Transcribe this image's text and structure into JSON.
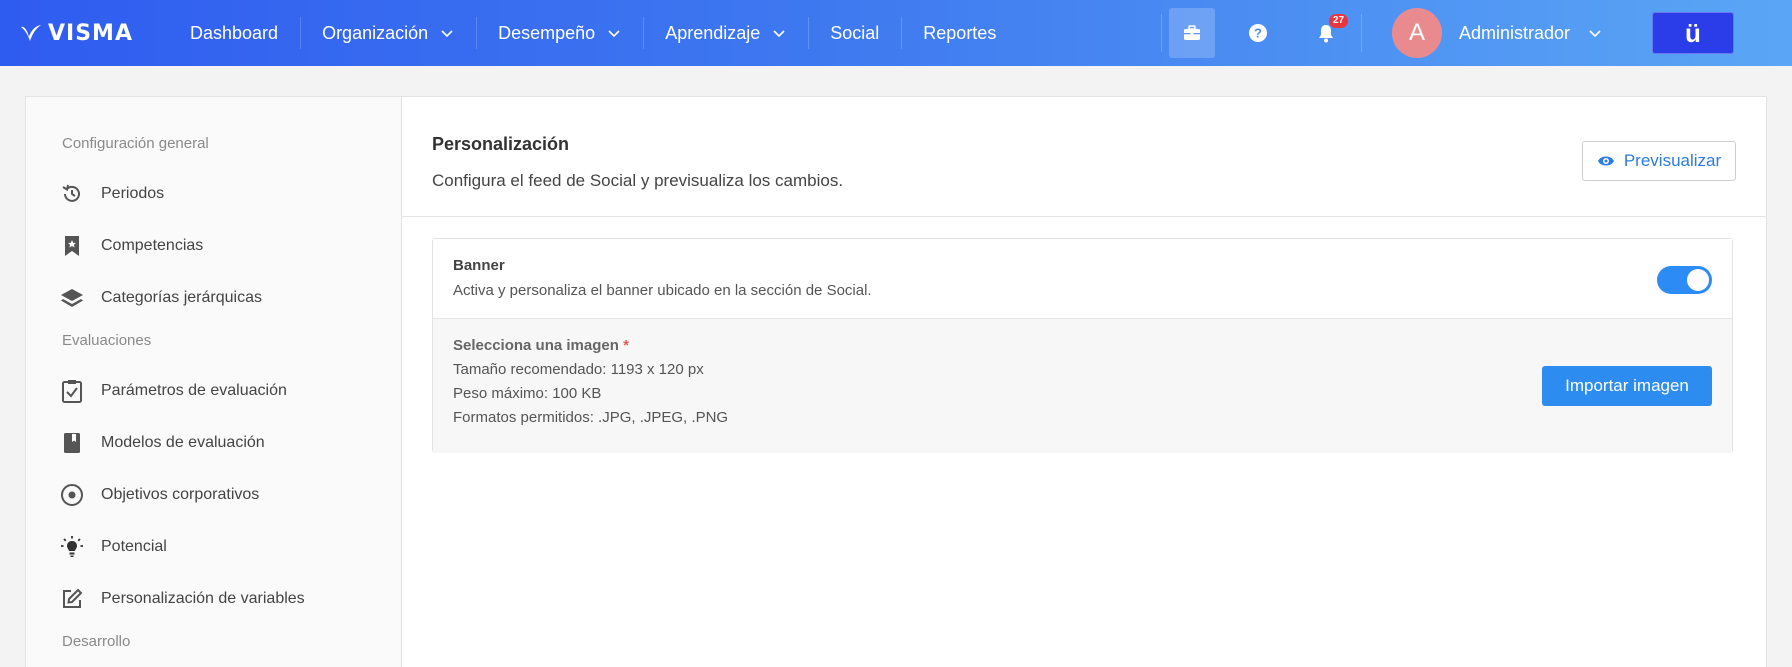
{
  "brand": {
    "logo_text": "VISMA"
  },
  "nav": {
    "items": [
      {
        "label": "Dashboard",
        "has_menu": false
      },
      {
        "label": "Organización",
        "has_menu": true
      },
      {
        "label": "Desempeño",
        "has_menu": true
      },
      {
        "label": "Aprendizaje",
        "has_menu": true
      },
      {
        "label": "Social",
        "has_menu": false
      },
      {
        "label": "Reportes",
        "has_menu": false
      }
    ]
  },
  "header": {
    "notifications_count": "27",
    "avatar_initial": "A",
    "user_name": "Administrador",
    "app_switch_label": "ü"
  },
  "sidebar": {
    "groups": [
      {
        "title": "Configuración general",
        "items": [
          {
            "label": "Periodos",
            "icon": "history-icon"
          },
          {
            "label": "Competencias",
            "icon": "bookmark-star-icon"
          },
          {
            "label": "Categorías jerárquicas",
            "icon": "layers-icon"
          }
        ]
      },
      {
        "title": "Evaluaciones",
        "items": [
          {
            "label": "Parámetros de evaluación",
            "icon": "clipboard-check-icon"
          },
          {
            "label": "Modelos de evaluación",
            "icon": "book-icon"
          },
          {
            "label": "Objetivos corporativos",
            "icon": "target-icon"
          },
          {
            "label": "Potencial",
            "icon": "lightbulb-icon"
          },
          {
            "label": "Personalización de variables",
            "icon": "edit-icon"
          }
        ]
      },
      {
        "title": "Desarrollo",
        "items": []
      }
    ]
  },
  "main": {
    "title": "Personalización",
    "subtitle": "Configura el feed de Social y previsualiza los cambios.",
    "preview_label": "Previsualizar",
    "banner": {
      "title": "Banner",
      "description": "Activa y personaliza el banner ubicado en la sección de Social.",
      "enabled": true,
      "image_label": "Selecciona una imagen",
      "required_mark": "*",
      "size_text": "Tamaño recomendado: 1193 x 120 px",
      "weight_text": "Peso máximo: 100 KB",
      "formats_text": "Formatos permitidos: .JPG, .JPEG, .PNG",
      "import_label": "Importar imagen"
    }
  },
  "colors": {
    "accent": "#2d8cf0",
    "topbar_start": "#2f5cf0",
    "topbar_end": "#5aa6f5",
    "badge": "#e8363e",
    "avatar": "#e98a8f"
  }
}
